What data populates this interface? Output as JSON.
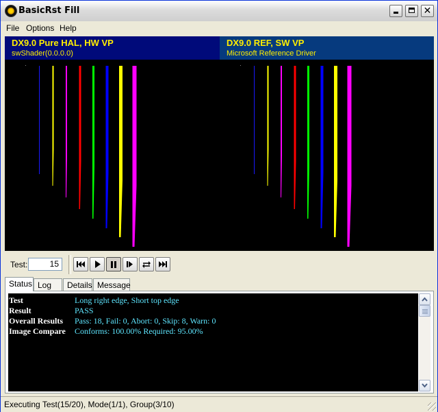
{
  "window": {
    "title": "BasicRst Fill",
    "app_icon": "directx-icon",
    "controls": [
      "minimize-icon",
      "maximize-icon",
      "close-icon"
    ],
    "close_glyph": "✕"
  },
  "menu": [
    "File",
    "Options",
    "Help"
  ],
  "panes": [
    {
      "title": "DX9.0 Pure HAL, HW VP",
      "subtitle": "swShader(0.0.0.0)",
      "header_color": "#000a7a",
      "lines": [
        {
          "color": "#1a1aff",
          "top_extent": 0.44,
          "bottom_extent": 0.6,
          "width": 1
        },
        {
          "color": "#ffff00",
          "top_extent": 0.47,
          "bottom_extent": 0.66,
          "width": 2
        },
        {
          "color": "#ff00ff",
          "top_extent": 0.5,
          "bottom_extent": 0.72,
          "width": 2
        },
        {
          "color": "#ff0000",
          "top_extent": 0.53,
          "bottom_extent": 0.78,
          "width": 3
        },
        {
          "color": "#00ff00",
          "top_extent": 0.56,
          "bottom_extent": 0.83,
          "width": 3
        },
        {
          "color": "#0000ff",
          "top_extent": 0.59,
          "bottom_extent": 0.88,
          "width": 4
        },
        {
          "color": "#ffff00",
          "top_extent": 0.63,
          "bottom_extent": 0.93,
          "width": 5
        },
        {
          "color": "#ff00ff",
          "top_extent": 0.66,
          "bottom_extent": 0.98,
          "width": 6
        }
      ]
    },
    {
      "title": "DX9.0 REF, SW VP",
      "subtitle": "Microsoft Reference Driver",
      "header_color": "#063a7e",
      "lines": [
        {
          "color": "#1a1aff",
          "top_extent": 0.44,
          "bottom_extent": 0.6,
          "width": 1
        },
        {
          "color": "#ffff00",
          "top_extent": 0.47,
          "bottom_extent": 0.66,
          "width": 2
        },
        {
          "color": "#ff00ff",
          "top_extent": 0.5,
          "bottom_extent": 0.72,
          "width": 2
        },
        {
          "color": "#ff0000",
          "top_extent": 0.53,
          "bottom_extent": 0.78,
          "width": 3
        },
        {
          "color": "#00ff00",
          "top_extent": 0.56,
          "bottom_extent": 0.83,
          "width": 3
        },
        {
          "color": "#0000ff",
          "top_extent": 0.59,
          "bottom_extent": 0.88,
          "width": 4
        },
        {
          "color": "#ffff00",
          "top_extent": 0.63,
          "bottom_extent": 0.93,
          "width": 5
        },
        {
          "color": "#ff00ff",
          "top_extent": 0.66,
          "bottom_extent": 0.98,
          "width": 6
        }
      ]
    }
  ],
  "test": {
    "label": "Test:",
    "value": "15"
  },
  "controls": [
    "skip-to-start-icon",
    "play-icon",
    "pause-icon",
    "step-forward-icon",
    "repeat-icon",
    "skip-to-end-icon"
  ],
  "tabs": [
    {
      "label": "Status",
      "active": true
    },
    {
      "label": "Log",
      "active": false
    },
    {
      "label": "Details",
      "active": false
    },
    {
      "label": "Message",
      "active": false
    }
  ],
  "status": {
    "rows": [
      {
        "key": "Test",
        "value": "Long right edge, Short top edge"
      },
      {
        "key": "Result",
        "value": "PASS"
      },
      {
        "key": "Overall Results",
        "value": "Pass: 18, Fail: 0, Abort: 0, Skip: 8, Warn: 0"
      },
      {
        "key": "Image Compare",
        "value": "Conforms: 100.00% Required: 95.00%"
      }
    ]
  },
  "colors": {
    "key_text": "#ffffff",
    "value_text": "#5ee6ff",
    "pane_title_text": "#ffee00"
  },
  "statusbar": {
    "text": "Executing Test(15/20), Mode(1/1), Group(3/10)"
  }
}
